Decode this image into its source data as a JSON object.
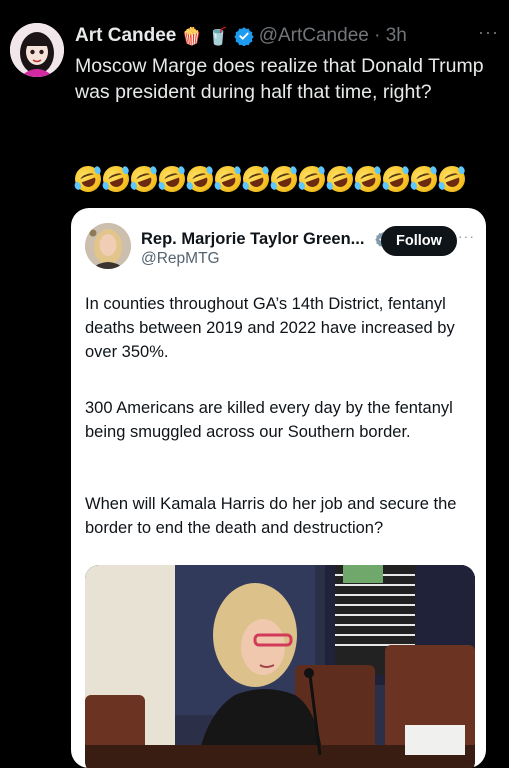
{
  "tweet": {
    "display_name": "Art Candee",
    "emoji_1": "🍿",
    "emoji_2": "🥤",
    "handle_meta": "@ArtCandee · 3h",
    "more": "···",
    "text": "Moscow Marge does realize that Donald Trump was president during half that time, right?",
    "laugh_emoji_count": 14
  },
  "quoted": {
    "name": "Rep. Marjorie Taylor Green...",
    "handle": "@RepMTG",
    "follow_label": "Follow",
    "more": "···",
    "paragraphs": [
      "In counties throughout GA’s 14th District, fentanyl deaths between 2019 and 2022 have increased by over 350%.",
      "300 Americans are killed every day by the fentanyl being smuggled across our Southern border.",
      "When will Kamala Harris do her job and secure the border to end the death and destruction?"
    ]
  },
  "colors": {
    "background": "#000000",
    "text_primary": "#e7e9ea",
    "text_secondary": "#71767b",
    "verified_blue": "#1d9bf0",
    "card_background": "#ffffff",
    "follow_button": "#0f1419"
  }
}
